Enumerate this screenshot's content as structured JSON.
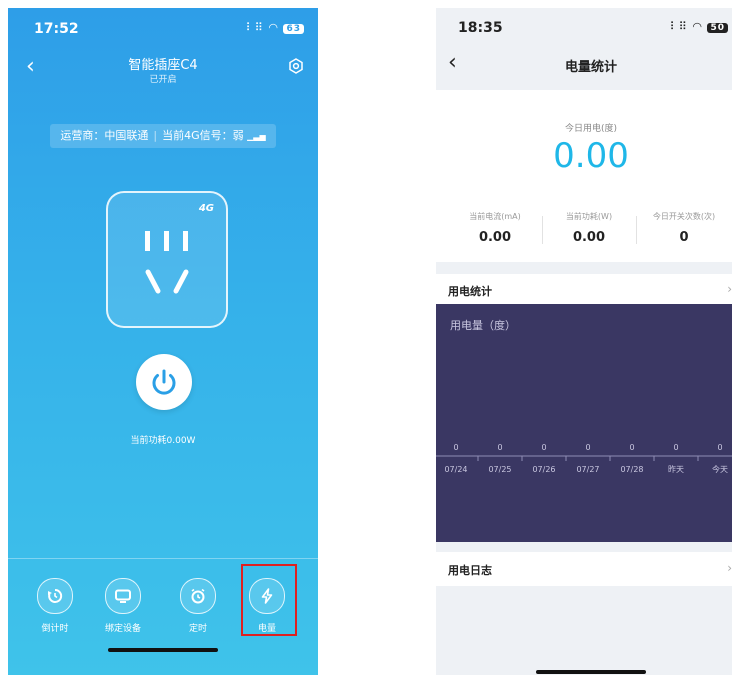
{
  "left": {
    "status_time": "17:52",
    "battery": "63",
    "title": "智能插座C4",
    "subtitle": "已开启",
    "carrier_label": "运营商：中国联通",
    "signal_label": "当前4G信号：弱",
    "socket_badge": "4G",
    "power_label": "当前功耗0.00W",
    "tabs": [
      {
        "label": "倒计时",
        "icon": "countdown-icon"
      },
      {
        "label": "绑定设备",
        "icon": "device-icon"
      },
      {
        "label": "定时",
        "icon": "alarm-clock-icon"
      },
      {
        "label": "电量",
        "icon": "lightning-icon"
      }
    ],
    "highlight_color": "#e02020"
  },
  "right": {
    "status_time": "18:35",
    "battery": "50",
    "title": "电量统计",
    "today_label": "今日用电(度)",
    "today_value": "0.00",
    "stats": [
      {
        "label": "当前电流(mA)",
        "value": "0.00"
      },
      {
        "label": "当前功耗(W)",
        "value": "0.00"
      },
      {
        "label": "今日开关次数(次)",
        "value": "0"
      }
    ],
    "section1_title": "用电统计",
    "section2_title": "用电日志",
    "accent_color": "#1fb7e8",
    "chart_bg": "#3a3763",
    "chart_data": {
      "type": "bar",
      "ylabel": "用电量（度）",
      "categories": [
        "07/24",
        "07/25",
        "07/26",
        "07/27",
        "07/28",
        "昨天",
        "今天"
      ],
      "values": [
        0,
        0,
        0,
        0,
        0,
        0,
        0
      ],
      "value_labels": [
        "0",
        "0",
        "0",
        "0",
        "0",
        "0",
        "0"
      ]
    }
  }
}
